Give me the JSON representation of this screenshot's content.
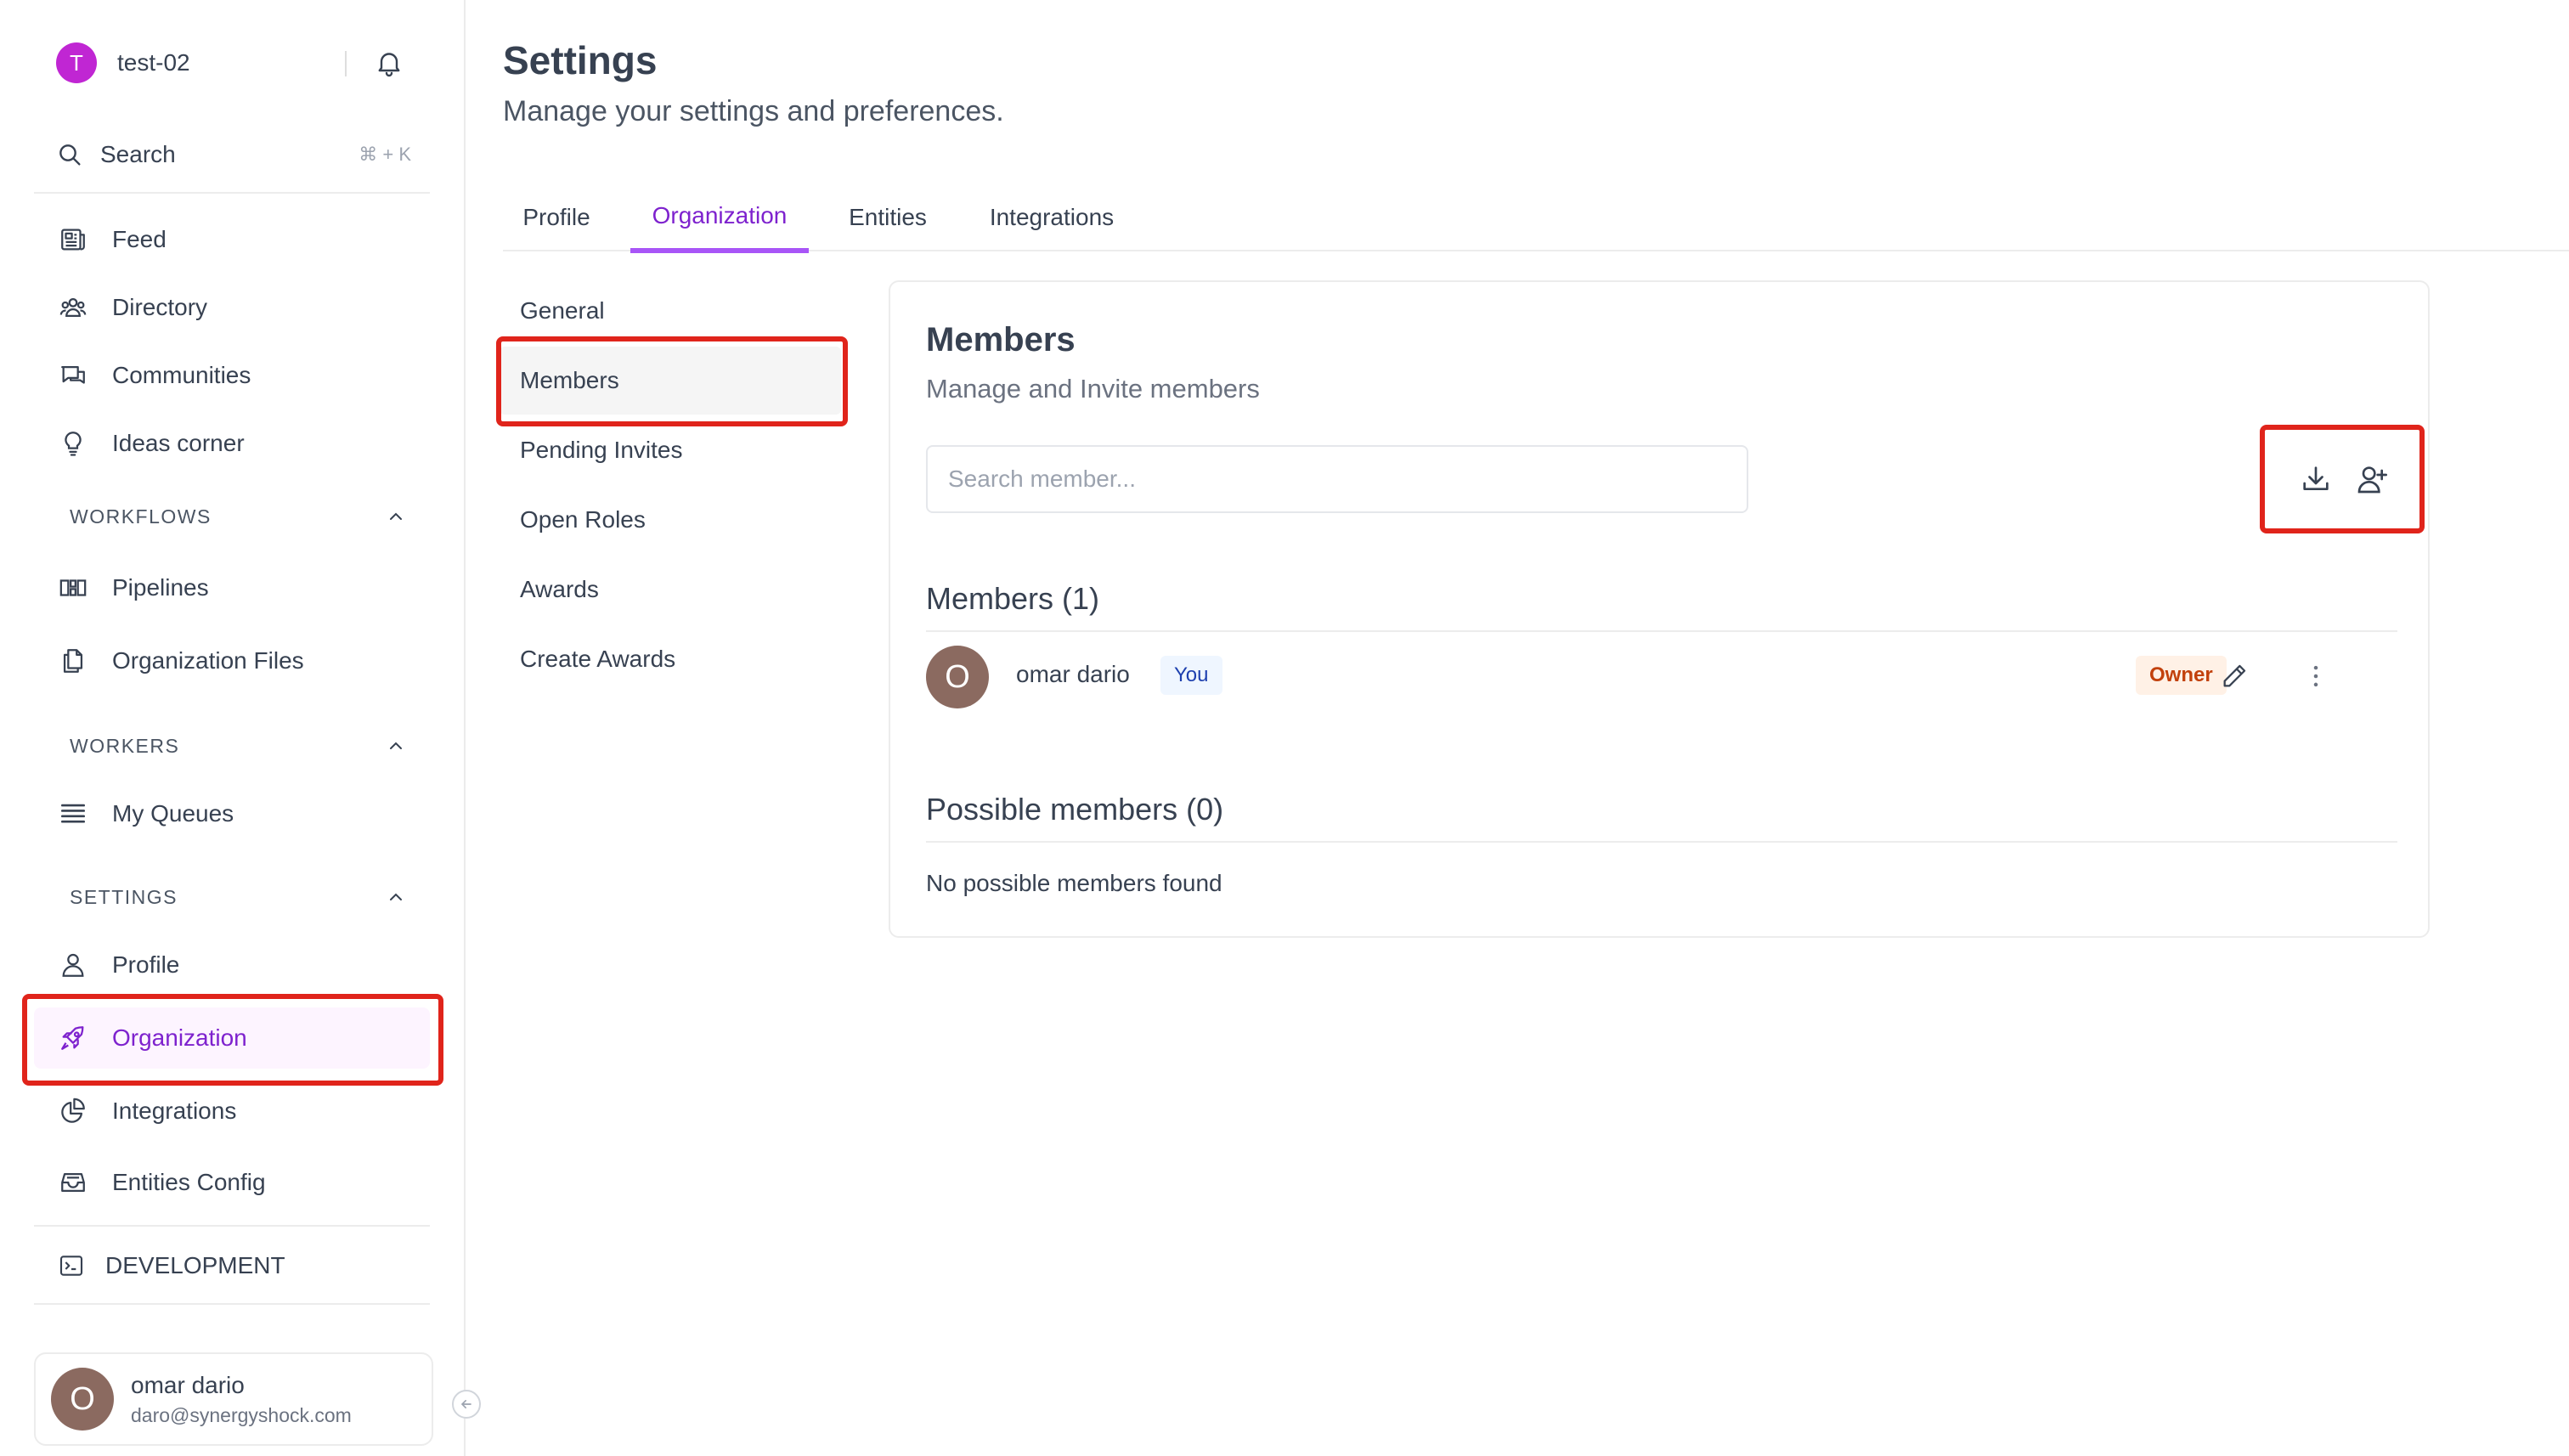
{
  "workspace": {
    "initial": "T",
    "name": "test-02",
    "avatar_color": "#c026d3"
  },
  "search": {
    "label": "Search",
    "shortcut": "⌘ + K"
  },
  "nav_main": [
    {
      "label": "Feed",
      "icon": "newspaper-icon"
    },
    {
      "label": "Directory",
      "icon": "users-icon"
    },
    {
      "label": "Communities",
      "icon": "chat-bubbles-icon"
    },
    {
      "label": "Ideas corner",
      "icon": "lightbulb-icon"
    }
  ],
  "sections": {
    "workflows": {
      "label": "WORKFLOWS",
      "items": [
        {
          "label": "Pipelines",
          "icon": "pipeline-icon"
        },
        {
          "label": "Organization Files",
          "icon": "files-icon"
        }
      ]
    },
    "workers": {
      "label": "WORKERS",
      "items": [
        {
          "label": "My Queues",
          "icon": "queue-list-icon"
        }
      ]
    },
    "settings": {
      "label": "SETTINGS",
      "items": [
        {
          "label": "Profile",
          "icon": "user-icon"
        },
        {
          "label": "Organization",
          "icon": "rocket-icon",
          "active": true
        },
        {
          "label": "Integrations",
          "icon": "pie-chart-icon"
        },
        {
          "label": "Entities Config",
          "icon": "inbox-stack-icon"
        }
      ]
    }
  },
  "development": {
    "label": "DEVELOPMENT",
    "icon": "terminal-icon"
  },
  "current_user": {
    "initial": "O",
    "name": "omar dario",
    "email": "daro@synergyshock.com",
    "avatar_color": "#8b6a60"
  },
  "page": {
    "title": "Settings",
    "subtitle": "Manage your settings and preferences."
  },
  "tabs": [
    {
      "label": "Profile"
    },
    {
      "label": "Organization",
      "active": true
    },
    {
      "label": "Entities"
    },
    {
      "label": "Integrations"
    }
  ],
  "subnav": [
    {
      "label": "General"
    },
    {
      "label": "Members",
      "active": true
    },
    {
      "label": "Pending Invites"
    },
    {
      "label": "Open Roles"
    },
    {
      "label": "Awards"
    },
    {
      "label": "Create Awards"
    }
  ],
  "members_card": {
    "title": "Members",
    "subtitle": "Manage and Invite members",
    "search_placeholder": "Search member...",
    "members_heading": "Members (1)",
    "possible_heading": "Possible members (0)",
    "possible_empty": "No possible members found",
    "members": [
      {
        "initial": "O",
        "name": "omar dario",
        "you_badge": "You",
        "role": "Owner"
      }
    ]
  },
  "colors": {
    "accent": "#7e22ce",
    "accent_underline": "#a855f7",
    "highlight_box": "#e0241b"
  }
}
